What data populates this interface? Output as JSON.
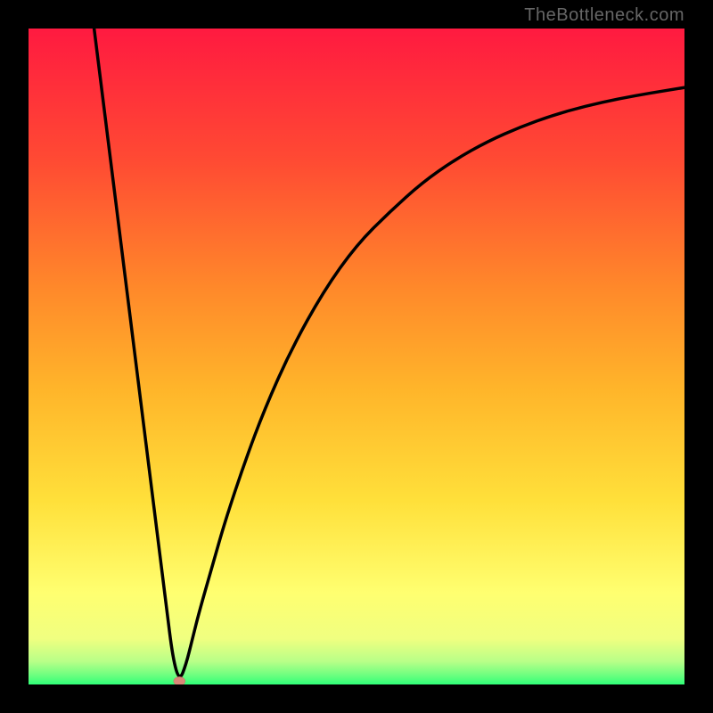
{
  "watermark": "TheBottleneck.com",
  "colors": {
    "background": "#000000",
    "gradient_top": "#ff1a40",
    "gradient_upper_mid": "#ff6a2a",
    "gradient_mid": "#ffb02a",
    "gradient_lower_mid": "#ffe03a",
    "gradient_lower": "#ffff66",
    "gradient_bottom": "#33ff77",
    "curve": "#000000",
    "marker_fill": "#d98878",
    "marker_stroke": "#c07060"
  },
  "chart_data": {
    "type": "line",
    "title": "",
    "xlabel": "",
    "ylabel": "",
    "xlim": [
      0,
      100
    ],
    "ylim": [
      0,
      100
    ],
    "series": [
      {
        "name": "curve",
        "x": [
          10,
          12,
          14,
          16,
          18,
          20,
          21,
          22,
          23,
          24,
          25,
          26,
          28,
          30,
          33,
          36,
          40,
          45,
          50,
          55,
          60,
          65,
          70,
          75,
          80,
          85,
          90,
          95,
          100
        ],
        "y": [
          100,
          84,
          68,
          52,
          36,
          20,
          12,
          4,
          0.5,
          3,
          7,
          11,
          18,
          25,
          34,
          42,
          51,
          60,
          67,
          72,
          76.5,
          80,
          82.8,
          85,
          86.8,
          88.2,
          89.3,
          90.2,
          91
        ]
      }
    ],
    "marker": {
      "x": 23,
      "y": 0.5
    },
    "background_gradient": [
      {
        "stop": 0.0,
        "color": "#ff1a40"
      },
      {
        "stop": 0.2,
        "color": "#ff4a33"
      },
      {
        "stop": 0.4,
        "color": "#ff8a2a"
      },
      {
        "stop": 0.55,
        "color": "#ffb52a"
      },
      {
        "stop": 0.72,
        "color": "#ffe03a"
      },
      {
        "stop": 0.86,
        "color": "#ffff70"
      },
      {
        "stop": 0.93,
        "color": "#f0ff80"
      },
      {
        "stop": 0.965,
        "color": "#b8ff88"
      },
      {
        "stop": 0.985,
        "color": "#70ff80"
      },
      {
        "stop": 1.0,
        "color": "#30ff78"
      }
    ]
  }
}
